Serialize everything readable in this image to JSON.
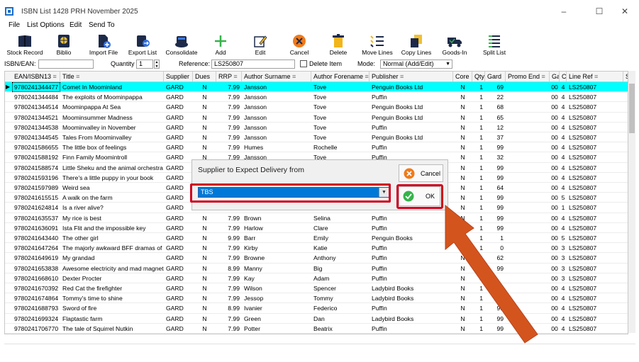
{
  "window": {
    "title": "ISBN List 1428 PRH November 2025",
    "minimize": "–",
    "maximize": "☐",
    "close": "✕"
  },
  "menu": [
    "File",
    "List Options",
    "Edit",
    "Send To"
  ],
  "toolbar": [
    {
      "label": "Stock Record",
      "icon": "book-icon"
    },
    {
      "label": "Biblio",
      "icon": "globe-book-icon"
    },
    {
      "label": "Import File",
      "icon": "import-file-icon"
    },
    {
      "label": "Export List",
      "icon": "export-list-icon"
    },
    {
      "label": "Consolidate",
      "icon": "consolidate-icon"
    },
    {
      "label": "Add",
      "icon": "plus-icon"
    },
    {
      "label": "Edit",
      "icon": "pencil-icon"
    },
    {
      "label": "Cancel",
      "icon": "cancel-icon"
    },
    {
      "label": "Delete",
      "icon": "trash-icon"
    },
    {
      "label": "Move Lines",
      "icon": "move-lines-icon"
    },
    {
      "label": "Copy Lines",
      "icon": "copy-lines-icon"
    },
    {
      "label": "Goods-In",
      "icon": "truck-icon"
    },
    {
      "label": "Split List",
      "icon": "split-list-icon"
    }
  ],
  "filter": {
    "isbn_label": "ISBN/EAN:",
    "isbn_value": "",
    "quantity_label": "Quantity",
    "quantity_value": "1",
    "reference_label": "Reference:",
    "reference_value": "LS250807",
    "delete_item_label": "Delete Item",
    "mode_label": "Mode:",
    "mode_value": "Normal (Add/Edit)"
  },
  "grid": {
    "columns": [
      "EAN/ISBN13",
      "Title",
      "Supplier",
      "Dues",
      "RRP",
      "Author Surname",
      "Author Forename",
      "Publisher",
      "Core",
      "Qty",
      "Gard",
      "Promo End",
      "Ga",
      "C",
      "Line Ref",
      "S"
    ],
    "rows": [
      [
        "9780241344477",
        "Comet In Moominland",
        "GARD",
        "N",
        "7.99",
        "Jansson",
        "Tove",
        "Penguin Books Ltd",
        "N",
        "1",
        "69",
        "",
        "00",
        "4",
        "LS250807"
      ],
      [
        "9780241344484",
        "The exploits of Moominpappa",
        "GARD",
        "N",
        "7.99",
        "Jansson",
        "Tove",
        "Puffin",
        "N",
        "1",
        "22",
        "",
        "00",
        "4",
        "LS250807"
      ],
      [
        "9780241344514",
        "Moominpappa At Sea",
        "GARD",
        "N",
        "7.99",
        "Jansson",
        "Tove",
        "Penguin Books Ltd",
        "N",
        "1",
        "68",
        "",
        "00",
        "4",
        "LS250807"
      ],
      [
        "9780241344521",
        "Moominsummer Madness",
        "GARD",
        "N",
        "7.99",
        "Jansson",
        "Tove",
        "Penguin Books Ltd",
        "N",
        "1",
        "65",
        "",
        "00",
        "4",
        "LS250807"
      ],
      [
        "9780241344538",
        "Moominvalley in November",
        "GARD",
        "N",
        "7.99",
        "Jansson",
        "Tove",
        "Puffin",
        "N",
        "1",
        "12",
        "",
        "00",
        "4",
        "LS250807"
      ],
      [
        "9780241344545",
        "Tales From Moominvalley",
        "GARD",
        "N",
        "7.99",
        "Jansson",
        "Tove",
        "Penguin Books Ltd",
        "N",
        "1",
        "37",
        "",
        "00",
        "4",
        "LS250807"
      ],
      [
        "9780241586655",
        "The little box of feelings",
        "GARD",
        "N",
        "7.99",
        "Humes",
        "Rochelle",
        "Puffin",
        "N",
        "1",
        "99",
        "",
        "00",
        "4",
        "LS250807"
      ],
      [
        "9780241588192",
        "Finn Family Moomintroll",
        "GARD",
        "N",
        "7.99",
        "Jansson",
        "Tove",
        "Puffin",
        "N",
        "1",
        "32",
        "",
        "00",
        "4",
        "LS250807"
      ],
      [
        "9780241588574",
        "Little Sheku and the animal orchestra",
        "GARD",
        "",
        "",
        "",
        "",
        "",
        "N",
        "1",
        "99",
        "",
        "00",
        "4",
        "LS250807"
      ],
      [
        "9780241593196",
        "There's a little puppy in your book",
        "GARD",
        "",
        "",
        "",
        "",
        "",
        "N",
        "1",
        "99",
        "",
        "00",
        "4",
        "LS250807"
      ],
      [
        "9780241597989",
        "Weird sea",
        "GARD",
        "",
        "",
        "",
        "",
        "",
        "N",
        "1",
        "64",
        "",
        "00",
        "4",
        "LS250807"
      ],
      [
        "9780241615515",
        "A walk on the farm",
        "GARD",
        "",
        "",
        "",
        "",
        "",
        "N",
        "1",
        "99",
        "",
        "00",
        "5",
        "LS250807"
      ],
      [
        "9780241624814",
        "Is a river alive?",
        "GARD",
        "",
        "",
        "",
        "",
        "",
        "N",
        "1",
        "99",
        "",
        "00",
        "1",
        "LS250807"
      ],
      [
        "9780241635537",
        "My rice is best",
        "GARD",
        "N",
        "7.99",
        "Brown",
        "Selina",
        "Puffin",
        "N",
        "1",
        "99",
        "",
        "00",
        "4",
        "LS250807"
      ],
      [
        "9780241636091",
        "Ista Flit and the impossible key",
        "GARD",
        "N",
        "7.99",
        "Harlow",
        "Clare",
        "Puffin",
        "N",
        "1",
        "99",
        "",
        "00",
        "4",
        "LS250807"
      ],
      [
        "9780241643440",
        "The other girl",
        "GARD",
        "N",
        "9.99",
        "Barr",
        "Emily",
        "Penguin Books",
        "N",
        "1",
        "1",
        "",
        "00",
        "5",
        "LS250807"
      ],
      [
        "9780241647264",
        "The majorly awkward BFF dramas of L",
        "GARD",
        "N",
        "7.99",
        "Kirby",
        "Katie",
        "Puffin",
        "N",
        "1",
        "0",
        "",
        "00",
        "3",
        "LS250807"
      ],
      [
        "9780241649619",
        "My grandad",
        "GARD",
        "N",
        "7.99",
        "Browne",
        "Anthony",
        "Puffin",
        "N",
        "1",
        "62",
        "",
        "00",
        "3",
        "LS250807"
      ],
      [
        "9780241653838",
        "Awesome electricity and mad magnets",
        "GARD",
        "N",
        "8.99",
        "Manny",
        "Big",
        "Puffin",
        "N",
        "1",
        "99",
        "",
        "00",
        "3",
        "LS250807"
      ],
      [
        "9780241668610",
        "Dexter Procter",
        "GARD",
        "N",
        "7.99",
        "Kay",
        "Adam",
        "Puffin",
        "N",
        "3",
        "",
        "",
        "00",
        "3",
        "LS250807"
      ],
      [
        "9780241670392",
        "Red Cat the firefighter",
        "GARD",
        "N",
        "7.99",
        "Wilson",
        "Spencer",
        "Ladybird Books",
        "N",
        "1",
        "",
        "",
        "00",
        "4",
        "LS250807"
      ],
      [
        "9780241674864",
        "Tommy's time to shine",
        "GARD",
        "N",
        "7.99",
        "Jessop",
        "Tommy",
        "Ladybird Books",
        "N",
        "1",
        "99",
        "",
        "00",
        "4",
        "LS250807"
      ],
      [
        "9780241688793",
        "Sword of fire",
        "GARD",
        "N",
        "8.99",
        "Ivanier",
        "Federico",
        "Puffin",
        "N",
        "1",
        "99",
        "",
        "00",
        "4",
        "LS250807"
      ],
      [
        "9780241699324",
        "Flaptastic farm",
        "GARD",
        "N",
        "7.99",
        "Green",
        "Dan",
        "Ladybird Books",
        "N",
        "1",
        "99",
        "",
        "00",
        "4",
        "LS250807"
      ],
      [
        "9780241706770",
        "The tale of Squirrel Nutkin",
        "GARD",
        "N",
        "7.99",
        "Potter",
        "Beatrix",
        "Puffin",
        "N",
        "1",
        "99",
        "",
        "00",
        "4",
        "LS250807"
      ]
    ]
  },
  "dialog": {
    "title": "Supplier to Expect Delivery from",
    "supplier_value": "TBS",
    "cancel_label": "Cancel",
    "ok_label": "OK"
  },
  "colors": {
    "selection": "#00ffff",
    "highlight": "#d0021b",
    "arrow": "#d4541e",
    "combo": "#0078d7"
  }
}
